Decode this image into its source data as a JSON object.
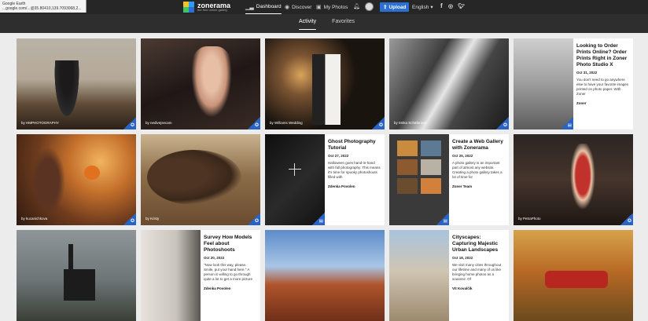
{
  "browser": {
    "tab_title": "Google Earth",
    "url": "...google.com/...@35.80410,139.7093068,2..."
  },
  "brand": {
    "name": "zonerama",
    "tagline": "the free online gallery",
    "accent": "#2a6fd1"
  },
  "nav": {
    "dashboard": "Dashboard",
    "discover": "Discover",
    "my_photos": "My Photos",
    "upload": "Upload",
    "language": "English"
  },
  "tabs": {
    "activity": "Activity",
    "favorites": "Favorites"
  },
  "cards": {
    "c1": {
      "credit": "by HMPHOTOGRAPHY"
    },
    "c2": {
      "credit": "by nedivejsecam"
    },
    "c3": {
      "credit": "by Williams Wedding"
    },
    "c4": {
      "credit": "by Mirka Schäferová"
    },
    "c5": {
      "title": "Looking to Order Prints Online? Order Prints Right in Zoner Photo Studio X",
      "date": "Oct 31, 2022",
      "body": "You don't need to go anywhere else to have your favorite images printed on photo paper. With Zoner",
      "author": "Zoner"
    },
    "c6": {
      "credit": "by kucanichkova"
    },
    "c7": {
      "credit": "by Kristy"
    },
    "c8": {
      "title": "Ghost Photography Tutorial",
      "date": "Oct 27, 2022",
      "body": "Halloween goes hand-in-hand with fall photography. This means it's time for spooky photoshoots filled with",
      "author": "Zdenka Povolen"
    },
    "c9": {
      "title": "Create a Web Gallery with Zonerama",
      "date": "Oct 25, 2022",
      "body": "A photo gallery is an important part of almost any website. Creating a photo gallery takes a lot of time for",
      "author": "Zoner Team"
    },
    "c10": {
      "credit": "by PetraPhoto"
    },
    "c12": {
      "title": "Survey How Models Feel about Photoshoots",
      "date": "Oct 20, 2022",
      "body": "\"Now look this way, please. Smile, put your hand here.\" A person is willing to go through quite a lot to get a more picture",
      "author": "Zdenka Povolen"
    },
    "c14": {
      "title": "Cityscapes: Capturing Majestic Urban Landscapes",
      "date": "Oct 18, 2022",
      "body": "We visit many cities throughout our lifetime and many of us like bringing home photos as a souvenir. Of",
      "author": "Vít Kovalčík"
    }
  }
}
